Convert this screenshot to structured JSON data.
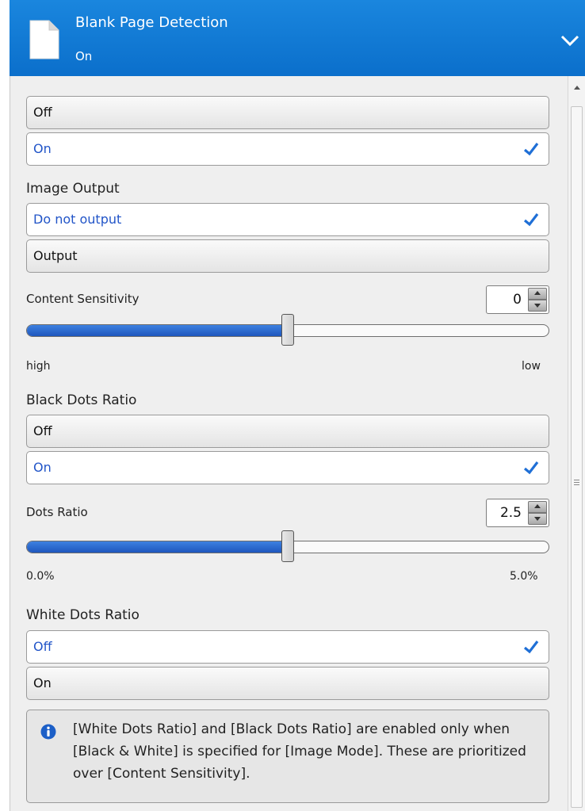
{
  "header": {
    "title": "Blank Page Detection",
    "value": "On"
  },
  "blank_page_options": [
    {
      "label": "Off",
      "selected": false
    },
    {
      "label": "On",
      "selected": true
    }
  ],
  "image_output": {
    "label": "Image Output",
    "options": [
      {
        "label": "Do not output",
        "selected": true
      },
      {
        "label": "Output",
        "selected": false
      }
    ]
  },
  "content_sensitivity": {
    "label": "Content Sensitivity",
    "value": "0",
    "level": 0.5,
    "min_label": "high",
    "max_label": "low"
  },
  "black_dots_ratio": {
    "label": "Black Dots Ratio",
    "options": [
      {
        "label": "Off",
        "selected": false
      },
      {
        "label": "On",
        "selected": true
      }
    ]
  },
  "dots_ratio": {
    "label": "Dots Ratio",
    "value": "2.5",
    "level": 0.5,
    "min_label": "0.0%",
    "max_label": "5.0%"
  },
  "white_dots_ratio": {
    "label": "White Dots Ratio",
    "options": [
      {
        "label": "Off",
        "selected": true
      },
      {
        "label": "On",
        "selected": false
      }
    ]
  },
  "info": {
    "icon": "info-icon",
    "text": "[White Dots Ratio] and [Black Dots Ratio] are enabled only when [Black & White] is specified for [Image Mode]. These are prioritized over [Content Sensitivity]."
  },
  "colors": {
    "header": "#0b6fcb",
    "selected_text": "#2255c8",
    "slider_fill": "#1e56bd"
  }
}
